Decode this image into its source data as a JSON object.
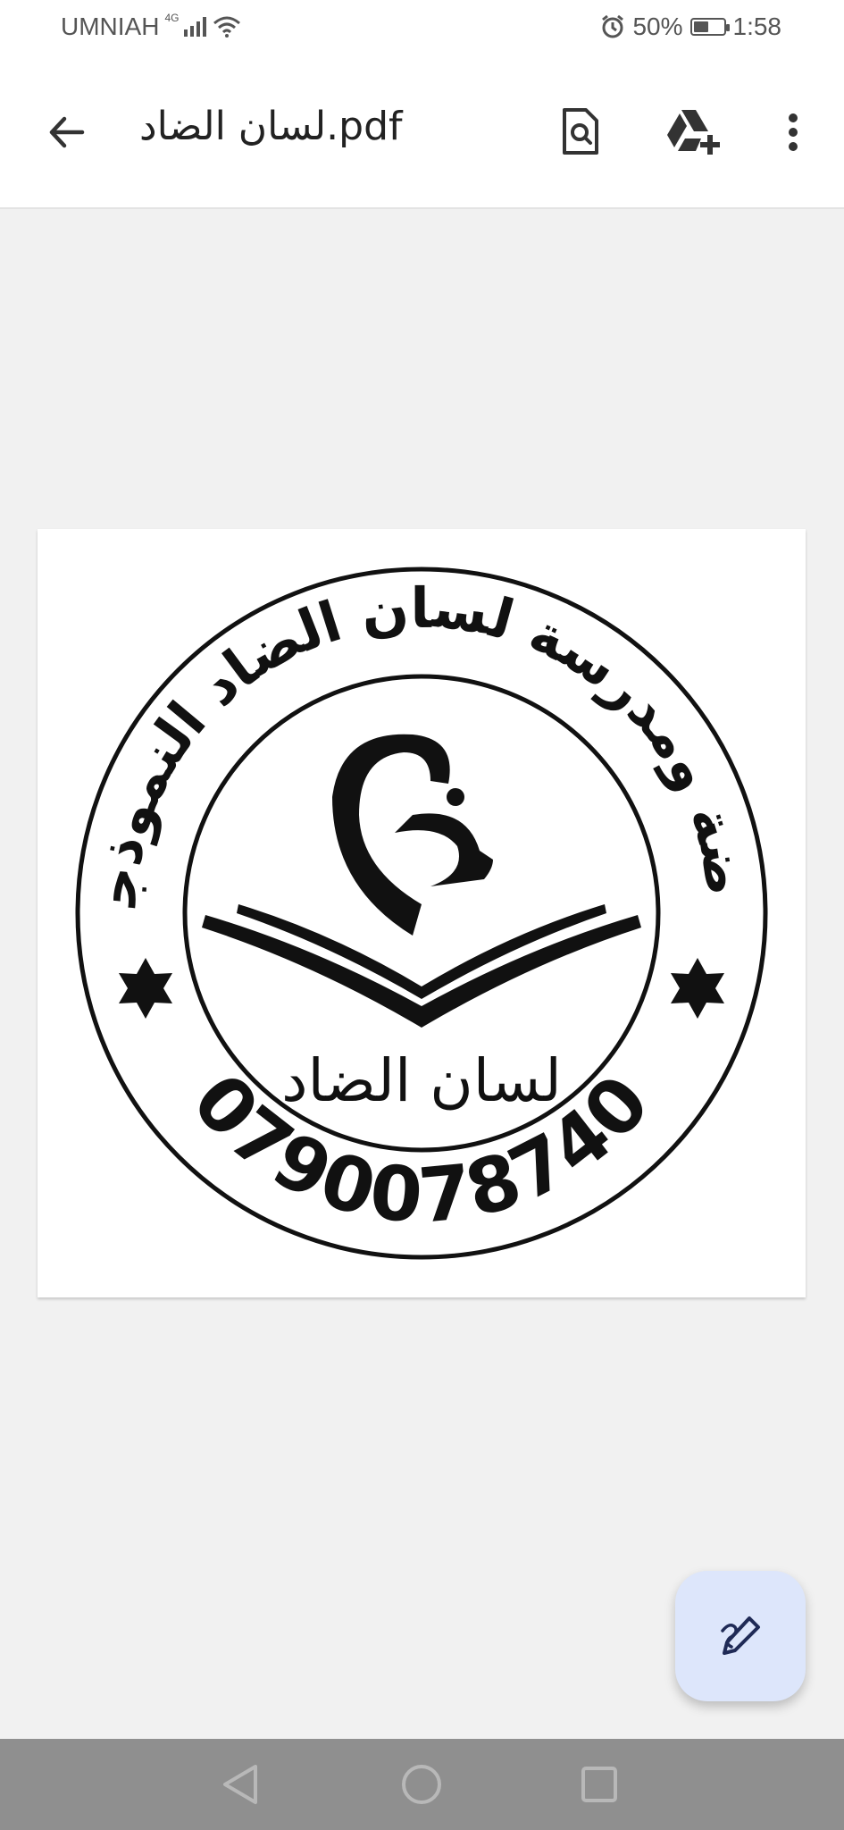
{
  "status_bar": {
    "carrier": "UMNIAH",
    "network_type": "4G",
    "battery_percent": "50%",
    "battery_level": 0.5,
    "time": "1:58"
  },
  "app_bar": {
    "title": "لسان الضاد.pdf",
    "icons": [
      "back-arrow-icon",
      "search-document-icon",
      "add-to-drive-icon",
      "more-vert-icon"
    ]
  },
  "document": {
    "seal_outer_text": "روضة ومدرسة لسان الضاد النموذجية",
    "seal_phone": "0790078740",
    "seal_center_text": "لسان الضاد",
    "seal_icons": [
      "open-book-icon",
      "arabic-letter-dad-icon",
      "star-icon"
    ]
  },
  "fab": {
    "icon": "edit-pen-icon"
  },
  "nav_bar": {
    "icons": [
      "nav-back-icon",
      "nav-home-icon",
      "nav-recent-icon"
    ]
  },
  "colors": {
    "background": "#f1f1f1",
    "fab_background": "#dde6fb",
    "fab_icon": "#1f2a56",
    "nav_bar": "#8f8f8f"
  }
}
